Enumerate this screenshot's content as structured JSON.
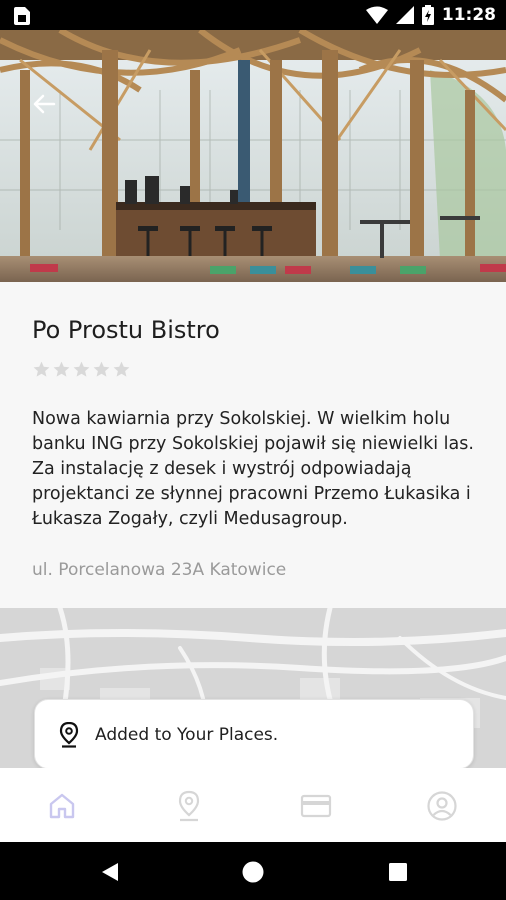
{
  "status_bar": {
    "time": "11:28",
    "icons": [
      "sim-card-icon",
      "wifi-icon",
      "signal-icon",
      "battery-icon"
    ]
  },
  "header": {
    "back_icon": "arrow-back-icon"
  },
  "place": {
    "name": "Po Prostu Bistro",
    "rating": 0,
    "rating_max": 5,
    "description": "Nowa kawiarnia przy Sokolskiej. W wielkim holu banku ING przy Sokolskiej pojawił się niewielki las. Za instalację z desek i wystrój odpowiadają projektanci ze słynnej pracowni Przemo Łukasika i Łukasza Zogały, czyli Medusagroup.",
    "address": "ul. Porcelanowa 23A Katowice"
  },
  "toast": {
    "message": "Added to Your Places.",
    "icon": "location-pin-icon"
  },
  "bottom_nav": {
    "items": [
      {
        "icon": "home-icon",
        "active": true
      },
      {
        "icon": "location-icon",
        "active": false
      },
      {
        "icon": "card-icon",
        "active": false
      },
      {
        "icon": "profile-icon",
        "active": false
      }
    ],
    "active_color": "#c9c7ef",
    "inactive_color": "#d6d6d6"
  },
  "system_nav": {
    "icons": [
      "back-triangle-icon",
      "home-circle-icon",
      "recents-square-icon"
    ]
  }
}
